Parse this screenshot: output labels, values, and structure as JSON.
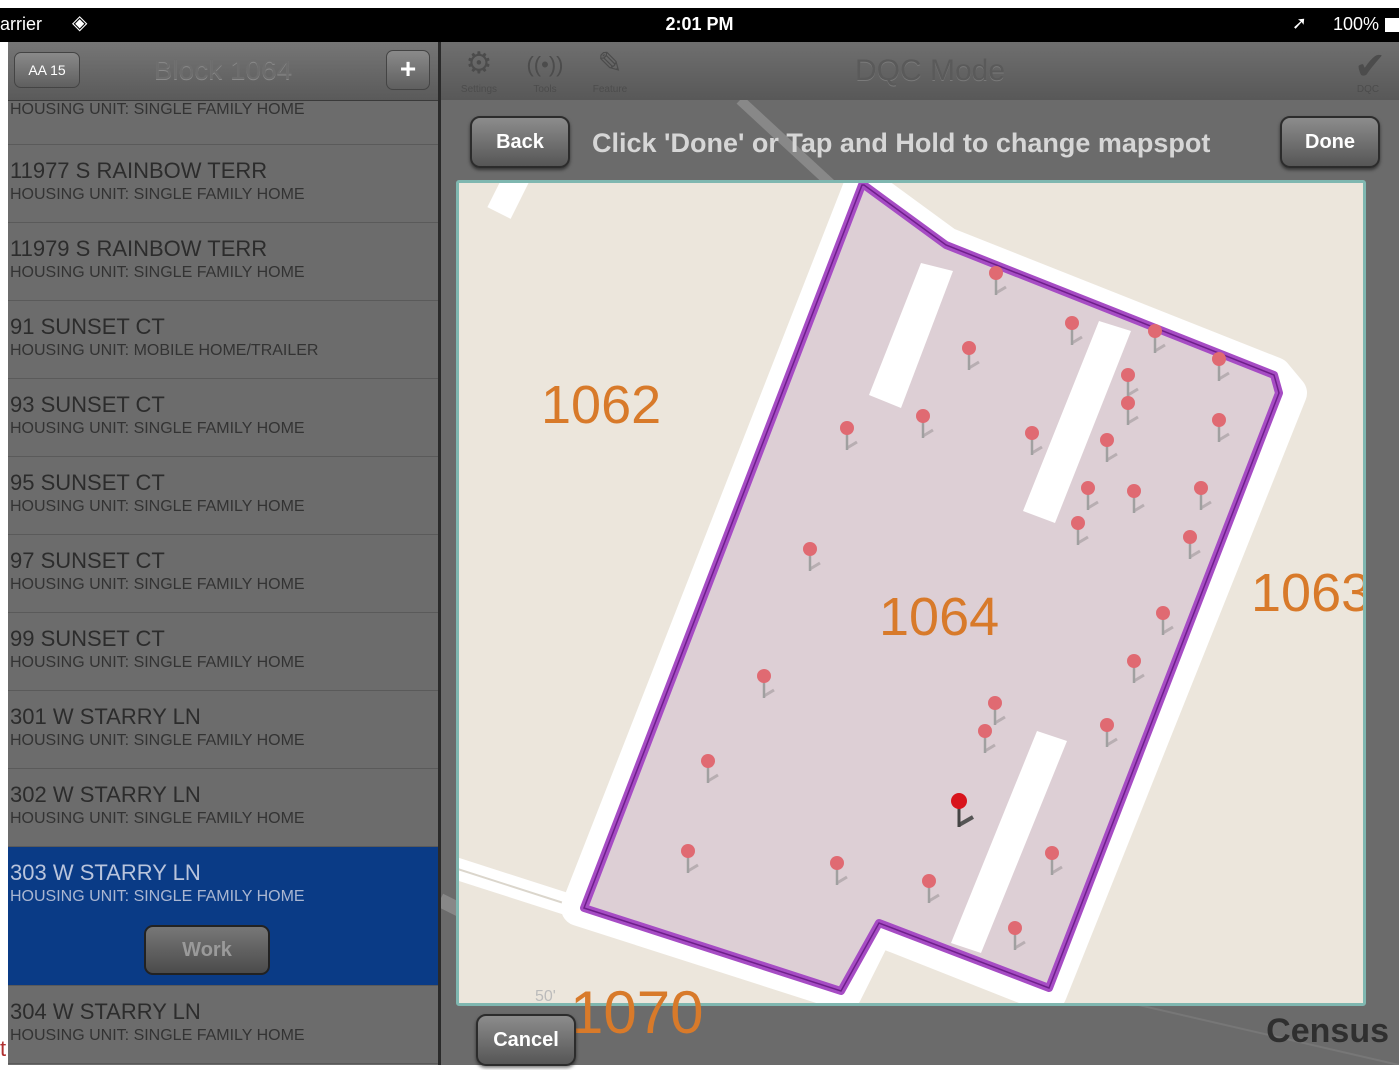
{
  "status_bar": {
    "carrier": "arrier",
    "time": "2:01 PM",
    "battery": "100%"
  },
  "sidebar": {
    "aa_button": "AA 15",
    "title": "Block 1064",
    "add_button": "+",
    "first_row_type": "HOUSING UNIT: SINGLE FAMILY HOME",
    "rows": [
      {
        "address": "11977 S RAINBOW TERR",
        "type": "HOUSING UNIT: SINGLE FAMILY HOME"
      },
      {
        "address": "11979 S RAINBOW TERR",
        "type": "HOUSING UNIT: SINGLE FAMILY HOME"
      },
      {
        "address": "91 SUNSET CT",
        "type": "HOUSING UNIT: MOBILE HOME/TRAILER"
      },
      {
        "address": "93 SUNSET CT",
        "type": "HOUSING UNIT: SINGLE FAMILY HOME"
      },
      {
        "address": "95 SUNSET CT",
        "type": "HOUSING UNIT: SINGLE FAMILY HOME"
      },
      {
        "address": "97 SUNSET CT",
        "type": "HOUSING UNIT: SINGLE FAMILY HOME"
      },
      {
        "address": "99 SUNSET CT",
        "type": "HOUSING UNIT: SINGLE FAMILY HOME"
      },
      {
        "address": "301 W STARRY LN",
        "type": "HOUSING UNIT: SINGLE FAMILY HOME"
      },
      {
        "address": "302 W STARRY LN",
        "type": "HOUSING UNIT: SINGLE FAMILY HOME"
      }
    ],
    "selected_row": {
      "address": "303 W STARRY LN",
      "type": "HOUSING UNIT: SINGLE FAMILY HOME",
      "work_button": "Work"
    },
    "last_row": {
      "address": "304 W STARRY LN",
      "type": "HOUSING UNIT: SINGLE FAMILY HOME"
    }
  },
  "toolbar": {
    "settings_label": "Settings",
    "tools_label": "Tools",
    "feature_label": "Feature",
    "mode_title": "DQC Mode",
    "dqc_label": "DQC"
  },
  "map_dialog": {
    "back_button": "Back",
    "hint": "Click 'Done' or Tap and Hold to change mapspot",
    "done_button": "Done",
    "cancel_button": "Cancel",
    "block_labels": {
      "b1062": "1062",
      "b1064": "1064",
      "b1063": "1063",
      "b1070": "1070"
    },
    "scale_text": "50'",
    "watermark": "Census",
    "colors": {
      "block_label": "#d87a2a",
      "boundary": "#a64cc4",
      "block_fill": "#ddcfd5",
      "map_bg": "#ece6dc",
      "pin": "#e06a72",
      "selected_pin": "#d8141c"
    }
  },
  "edge_text": "t"
}
